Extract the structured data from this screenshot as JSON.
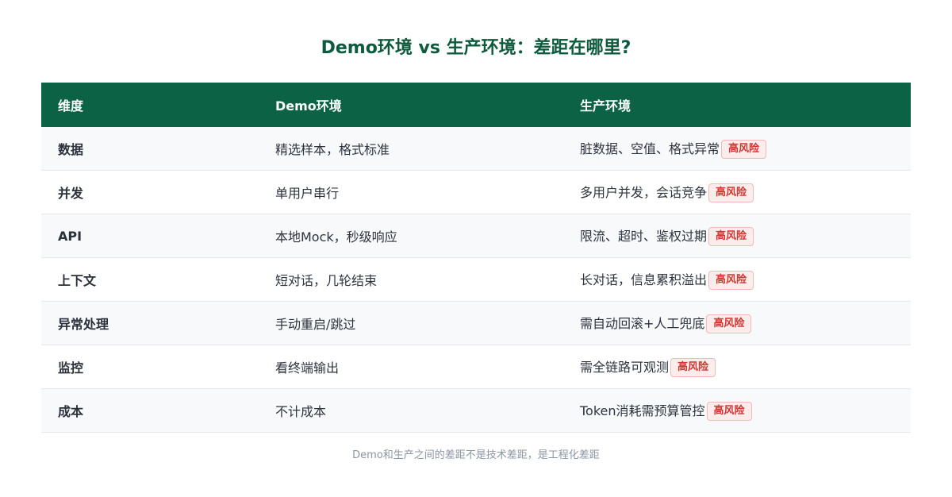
{
  "title": "Demo环境 vs 生产环境：差距在哪里?",
  "table": {
    "headers": [
      "维度",
      "Demo环境",
      "生产环境"
    ],
    "rows": [
      {
        "dimension": "数据",
        "demo": "精选样本，格式标准",
        "prod": "脏数据、空值、格式异常",
        "badge": "高风险"
      },
      {
        "dimension": "并发",
        "demo": "单用户串行",
        "prod": "多用户并发，会话竞争",
        "badge": "高风险"
      },
      {
        "dimension": "API",
        "demo": "本地Mock，秒级响应",
        "prod": "限流、超时、鉴权过期",
        "badge": "高风险"
      },
      {
        "dimension": "上下文",
        "demo": "短对话，几轮结束",
        "prod": "长对话，信息累积溢出",
        "badge": "高风险"
      },
      {
        "dimension": "异常处理",
        "demo": "手动重启/跳过",
        "prod": "需自动回滚+人工兜底",
        "badge": "高风险"
      },
      {
        "dimension": "监控",
        "demo": "看终端输出",
        "prod": "需全链路可观测",
        "badge": "高风险"
      },
      {
        "dimension": "成本",
        "demo": "不计成本",
        "prod": "Token消耗需预算管控",
        "badge": "高风险"
      }
    ]
  },
  "footer": "Demo和生产之间的差距不是技术差距，是工程化差距",
  "colors": {
    "header_bg": "#0b6244",
    "title": "#0e5a3c",
    "badge_text": "#d0352f",
    "badge_bg": "#fdecec"
  }
}
